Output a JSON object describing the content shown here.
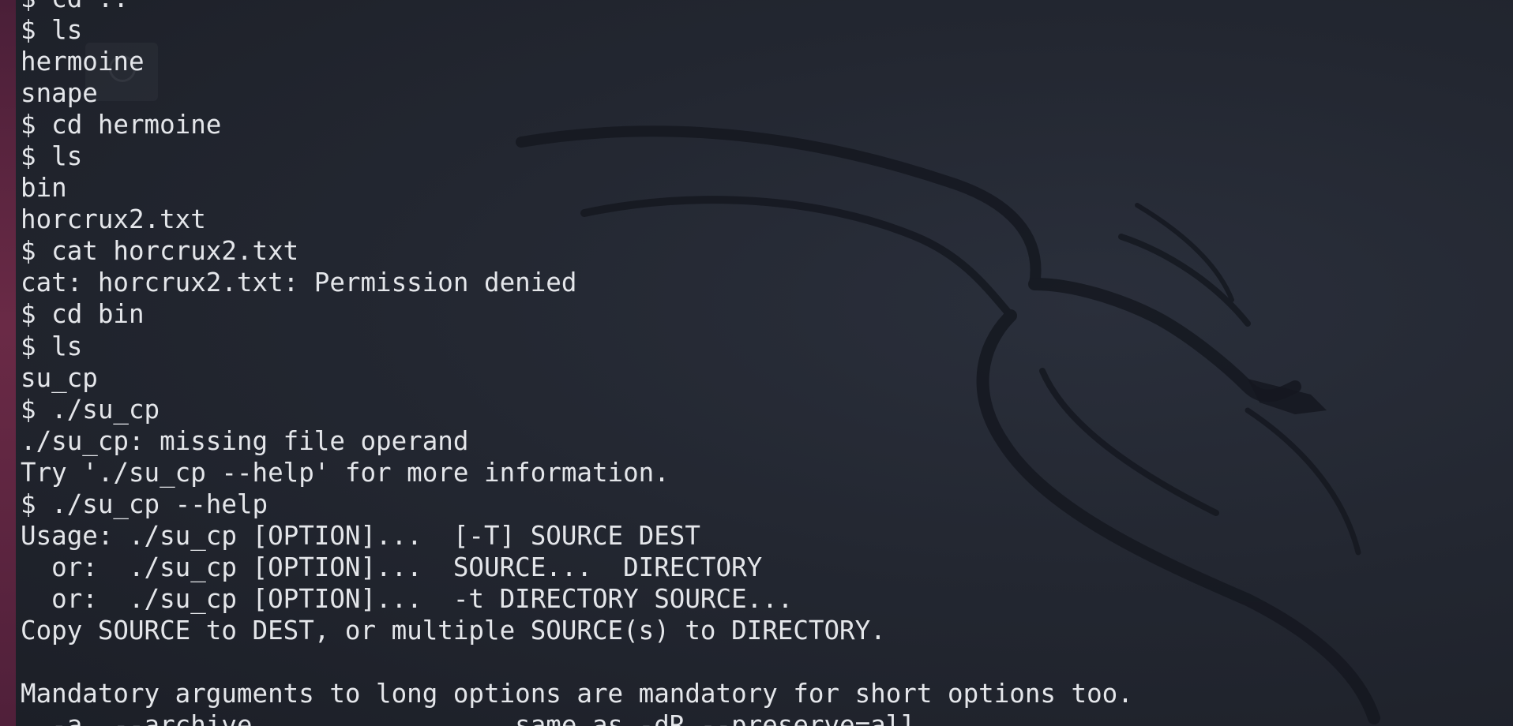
{
  "terminal": {
    "lines": [
      "$ cd ..",
      "$ ls",
      "hermoine",
      "snape",
      "$ cd hermoine",
      "$ ls",
      "bin",
      "horcrux2.txt",
      "$ cat horcrux2.txt",
      "cat: horcrux2.txt: Permission denied",
      "$ cd bin",
      "$ ls",
      "su_cp",
      "$ ./su_cp",
      "./su_cp: missing file operand",
      "Try './su_cp --help' for more information.",
      "$ ./su_cp --help",
      "Usage: ./su_cp [OPTION]...  [-T] SOURCE DEST",
      "  or:  ./su_cp [OPTION]...  SOURCE...  DIRECTORY",
      "  or:  ./su_cp [OPTION]...  -t DIRECTORY SOURCE...",
      "Copy SOURCE to DEST, or multiple SOURCE(s) to DIRECTORY.",
      "",
      "Mandatory arguments to long options are mandatory for short options too.",
      "  -a, --archive                 same as -dR --preserve=all"
    ]
  },
  "colors": {
    "background": "#1e222b",
    "text": "#e4e6ea",
    "left_strip": "#6a2a46",
    "wallpaper_dragon": "#151820"
  },
  "icons": {
    "wallpaper": "kali-dragon-icon",
    "desktop_ghost": "desktop-shortcut-icon"
  }
}
